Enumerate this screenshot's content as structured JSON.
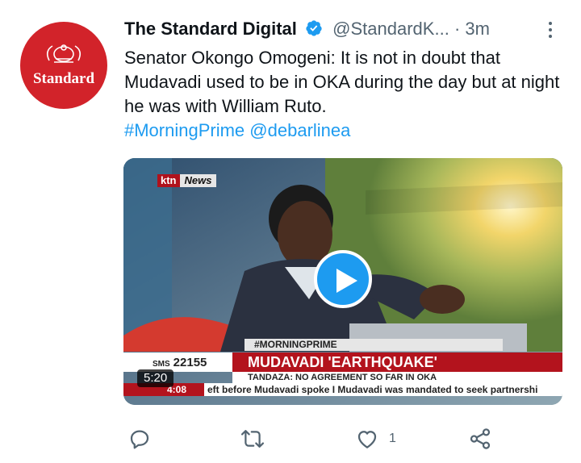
{
  "account": {
    "avatar_text": "Standard",
    "name": "The Standard Digital",
    "handle": "@StandardK...",
    "separator": "·",
    "time": "3m"
  },
  "tweet": {
    "text": "Senator Okongo Omogeni: It is not in doubt that Mudavadi used to be in OKA during the day but at night he was with William Ruto.",
    "hashtag": "#MorningPrime",
    "mention": "@debarlinea"
  },
  "video": {
    "channel_left": "ktn",
    "channel_right": "News",
    "show_tag": "#MORNINGPRIME",
    "sms_label": "SMS",
    "sms_number": "22155",
    "headline": "MUDAVADI 'EARTHQUAKE'",
    "subheadline": "TANDAZA: NO AGREEMENT SO FAR IN OKA",
    "ticker_time": "4:08",
    "ticker_text": "eft before Mudavadi spoke I Mudavadi was mandated to seek partnershi",
    "duration": "5:20"
  },
  "actions": {
    "like_count": "1"
  },
  "colors": {
    "avatar_red": "#d2232a",
    "accent_blue": "#1d9bf0",
    "banner_red": "#b3131d",
    "muted": "#536471"
  },
  "icons": [
    "verified-badge-icon",
    "more-icon",
    "play-icon",
    "reply-icon",
    "retweet-icon",
    "like-icon",
    "share-icon"
  ]
}
